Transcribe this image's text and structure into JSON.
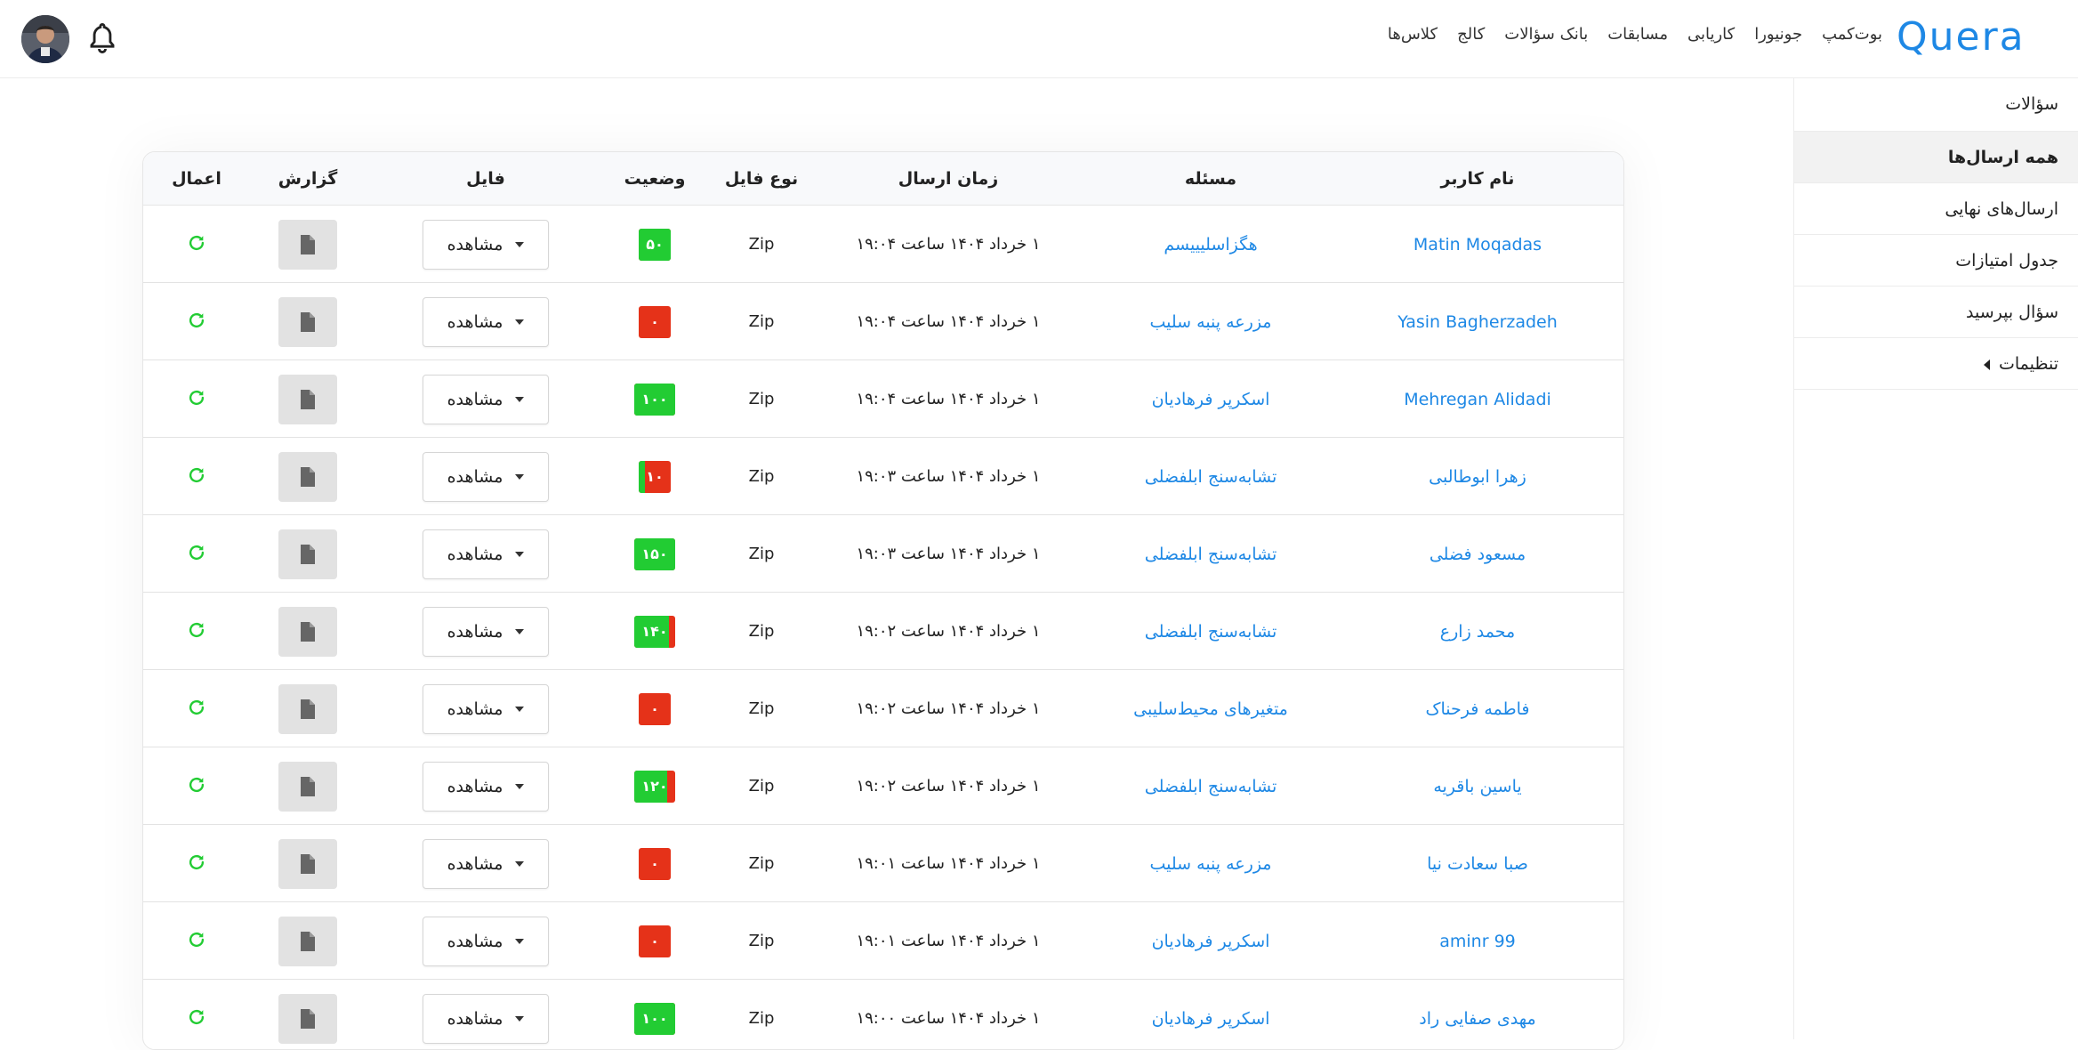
{
  "brand": {
    "logo_text": "Quera",
    "color": "#1e88e5"
  },
  "nav": [
    "کلاس‌ها",
    "کالج",
    "بانک سؤالات",
    "مسابقات",
    "کاریابی",
    "جونیورا",
    "بوت‌کمپ"
  ],
  "header_icons": {
    "bell": "bell-icon",
    "avatar": "user-avatar"
  },
  "sidebar": {
    "items": [
      {
        "label": "سؤالات",
        "active": false
      },
      {
        "label": "همه ارسال‌ها",
        "active": true
      },
      {
        "label": "ارسال‌های نهایی",
        "active": false
      },
      {
        "label": "جدول امتیازات",
        "active": false
      },
      {
        "label": "سؤال بپرسید",
        "active": false
      },
      {
        "label": "تنظیمات",
        "active": false,
        "has_caret": true
      }
    ]
  },
  "table": {
    "headers": {
      "user": "نام کاربر",
      "problem": "مسئله",
      "time": "زمان ارسال",
      "type": "نوع فایل",
      "status": "وضعیت",
      "file": "فایل",
      "report": "گزارش",
      "actions": "اعمال"
    },
    "view_label": "مشاهده",
    "colors": {
      "pass": "#22cc33",
      "fail": "#e53219",
      "link": "#1e88e5",
      "action": "#22cc33"
    },
    "rows": [
      {
        "user": "Matin Moqadas",
        "problem": "هگزاسلیییسم",
        "time": "۱ خرداد ۱۴۰۴ ساعت ۱۹:۰۴",
        "type": "Zip",
        "score": "۵۰",
        "pass_fraction": 1.0
      },
      {
        "user": "Yasin Bagherzadeh",
        "problem": "مزرعه پنبه سلیب",
        "time": "۱ خرداد ۱۴۰۴ ساعت ۱۹:۰۴",
        "type": "Zip",
        "score": "۰",
        "pass_fraction": 0.0
      },
      {
        "user": "Mehregan Alidadi",
        "problem": "اسکرپر فرهادیان",
        "time": "۱ خرداد ۱۴۰۴ ساعت ۱۹:۰۴",
        "type": "Zip",
        "score": "۱۰۰",
        "pass_fraction": 1.0
      },
      {
        "user": "زهرا ابوطالبی",
        "problem": "تشابه‌سنج ابلفضلی",
        "time": "۱ خرداد ۱۴۰۴ ساعت ۱۹:۰۳",
        "type": "Zip",
        "score": "۱۰",
        "pass_fraction": 0.2
      },
      {
        "user": "مسعود فضلی",
        "problem": "تشابه‌سنج ابلفضلی",
        "time": "۱ خرداد ۱۴۰۴ ساعت ۱۹:۰۳",
        "type": "Zip",
        "score": "۱۵۰",
        "pass_fraction": 1.0
      },
      {
        "user": "محمد زارع",
        "problem": "تشابه‌سنج ابلفضلی",
        "time": "۱ خرداد ۱۴۰۴ ساعت ۱۹:۰۲",
        "type": "Zip",
        "score": "۱۴۰",
        "pass_fraction": 0.85
      },
      {
        "user": "فاطمه فرحناک",
        "problem": "متغیرهای محیط‌سلیبی",
        "time": "۱ خرداد ۱۴۰۴ ساعت ۱۹:۰۲",
        "type": "Zip",
        "score": "۰",
        "pass_fraction": 0.0
      },
      {
        "user": "یاسین باقریه",
        "problem": "تشابه‌سنج ابلفضلی",
        "time": "۱ خرداد ۱۴۰۴ ساعت ۱۹:۰۲",
        "type": "Zip",
        "score": "۱۲۰",
        "pass_fraction": 0.8
      },
      {
        "user": "صبا سعادت نیا",
        "problem": "مزرعه پنبه سلیب",
        "time": "۱ خرداد ۱۴۰۴ ساعت ۱۹:۰۱",
        "type": "Zip",
        "score": "۰",
        "pass_fraction": 0.0
      },
      {
        "user": "aminr 99",
        "problem": "اسکرپر فرهادیان",
        "time": "۱ خرداد ۱۴۰۴ ساعت ۱۹:۰۱",
        "type": "Zip",
        "score": "۰",
        "pass_fraction": 0.0
      },
      {
        "user": "مهدی صفایی راد",
        "problem": "اسکرپر فرهادیان",
        "time": "۱ خرداد ۱۴۰۴ ساعت ۱۹:۰۰",
        "type": "Zip",
        "score": "۱۰۰",
        "pass_fraction": 1.0
      }
    ]
  }
}
